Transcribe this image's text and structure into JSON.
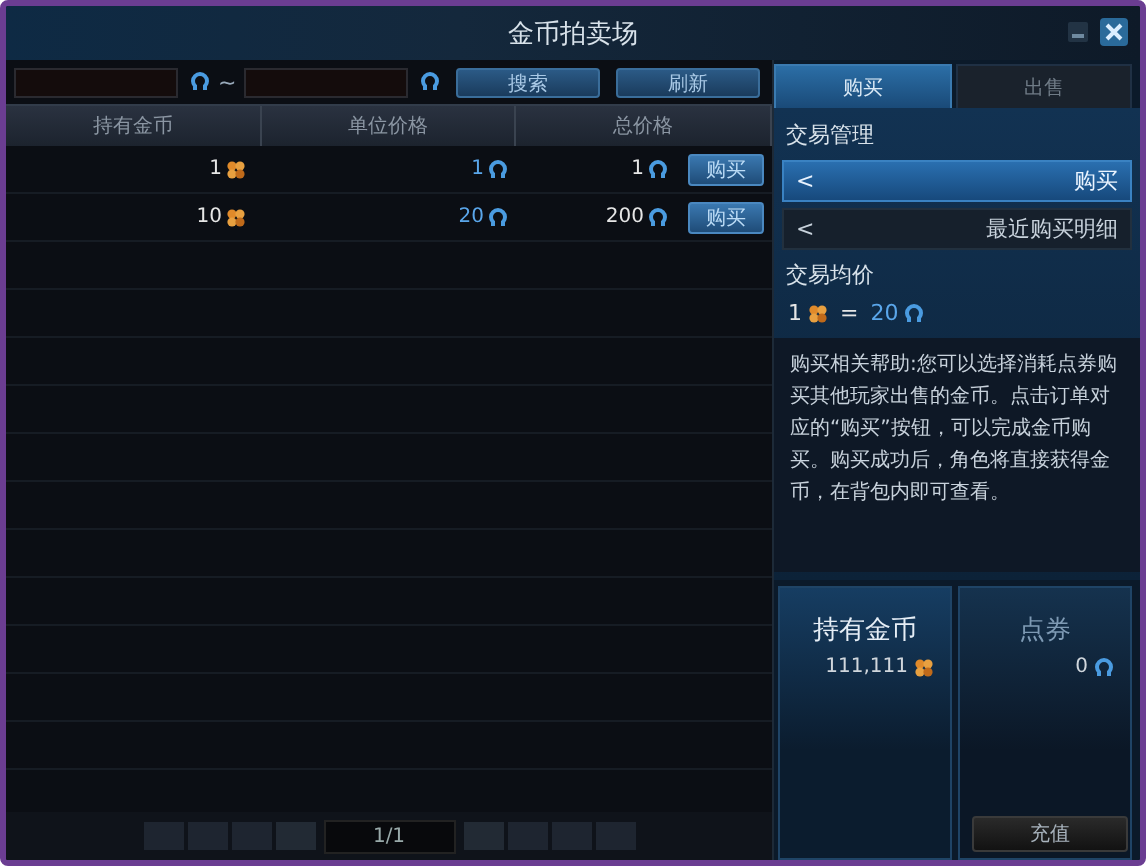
{
  "window": {
    "title": "金币拍卖场"
  },
  "search": {
    "separator": "~",
    "buttons": [
      "搜索",
      "刷新"
    ]
  },
  "table": {
    "columns": [
      "持有金币",
      "单位价格",
      "总价格"
    ],
    "rows": [
      {
        "coins": "1",
        "unit_price": "1",
        "total_price": "1",
        "action": "购买"
      },
      {
        "coins": "10",
        "unit_price": "20",
        "total_price": "200",
        "action": "购买"
      }
    ]
  },
  "pagination": {
    "page": "1/1"
  },
  "tabs": [
    {
      "label": "购买",
      "selected": true
    },
    {
      "label": "出售",
      "selected": false
    }
  ],
  "trade_management": {
    "title": "交易管理",
    "items": [
      {
        "arrow": "<",
        "label": "购买",
        "selected": true
      },
      {
        "arrow": "<",
        "label": "最近购买明细",
        "selected": false
      }
    ]
  },
  "average_price": {
    "title": "交易均价",
    "coins": "1",
    "equals": "=",
    "price": "20"
  },
  "help_text": "购买相关帮助:您可以选择消耗点券购买其他玩家出售的金币。点击订单对应的“购买”按钮，可以完成金币购买。购买成功后，角色将直接获得金币，在背包内即可查看。",
  "balances": [
    {
      "title": "持有金币",
      "value": "111,111",
      "kind": "coin"
    },
    {
      "title": "点券",
      "value": "0",
      "kind": "ticket"
    }
  ],
  "recharge_button": "充值"
}
